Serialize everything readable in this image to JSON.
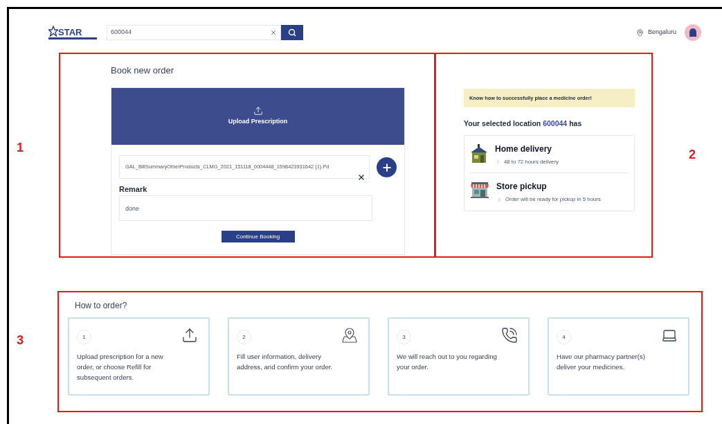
{
  "header": {
    "logo": {
      "text": "STAR"
    },
    "search": {
      "value": "600044"
    },
    "location": "Bengaluru"
  },
  "book_order": {
    "title": "Book new order",
    "upload_label": "Upload Prescription",
    "file_name": "GAL_BillSummaryOtherProducts_CLMG_2021_151118_0004448_1598423931642 (1).Pd",
    "remark_label": "Remark",
    "remark_value": "done",
    "continue_button": "Continue Booking"
  },
  "info": {
    "banner": "Know how to successfully place a medicine order!",
    "location_prefix": "Your selected location",
    "pincode": "600044",
    "location_suffix": "has",
    "options": [
      {
        "kind": "house",
        "title": "Home delivery",
        "detail": "48 to 72 hours delivery"
      },
      {
        "kind": "store",
        "title": "Store pickup",
        "detail": "Order will be ready for pickup in 5 hours"
      }
    ]
  },
  "how_to": {
    "title": "How to order?",
    "steps": [
      {
        "number": "1",
        "kind": "upload",
        "text": "Upload prescription for a new order, or choose Refill for subsequent orders."
      },
      {
        "number": "2",
        "kind": "map",
        "text": "Fill user information, delivery address, and confirm your order."
      },
      {
        "number": "3",
        "kind": "phone",
        "text": "We will reach out to you regarding your order."
      },
      {
        "number": "4",
        "kind": "laptop",
        "text": "Have our pharmacy partner(s) deliver your medicines."
      }
    ]
  },
  "annotations": [
    {
      "label": "1"
    },
    {
      "label": "2"
    },
    {
      "label": "3"
    }
  ]
}
